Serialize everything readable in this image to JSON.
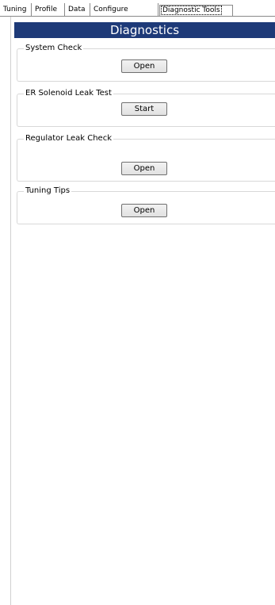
{
  "tabs": [
    {
      "label": "Tuning"
    },
    {
      "label": "Profile"
    },
    {
      "label": "Data"
    },
    {
      "label": "Configure"
    },
    {
      "label": "Diagnostic Tools",
      "active": true
    }
  ],
  "header": {
    "title": "Diagnostics"
  },
  "groups": [
    {
      "title": "System Check",
      "button_label": "Open"
    },
    {
      "title": "ER Solenoid Leak Test",
      "button_label": "Start"
    },
    {
      "title": "Regulator Leak Check",
      "button_label": "Open"
    },
    {
      "title": "Tuning Tips",
      "button_label": "Open"
    }
  ],
  "colors": {
    "header_bg": "#1e3a78",
    "header_text": "#ffffff"
  }
}
